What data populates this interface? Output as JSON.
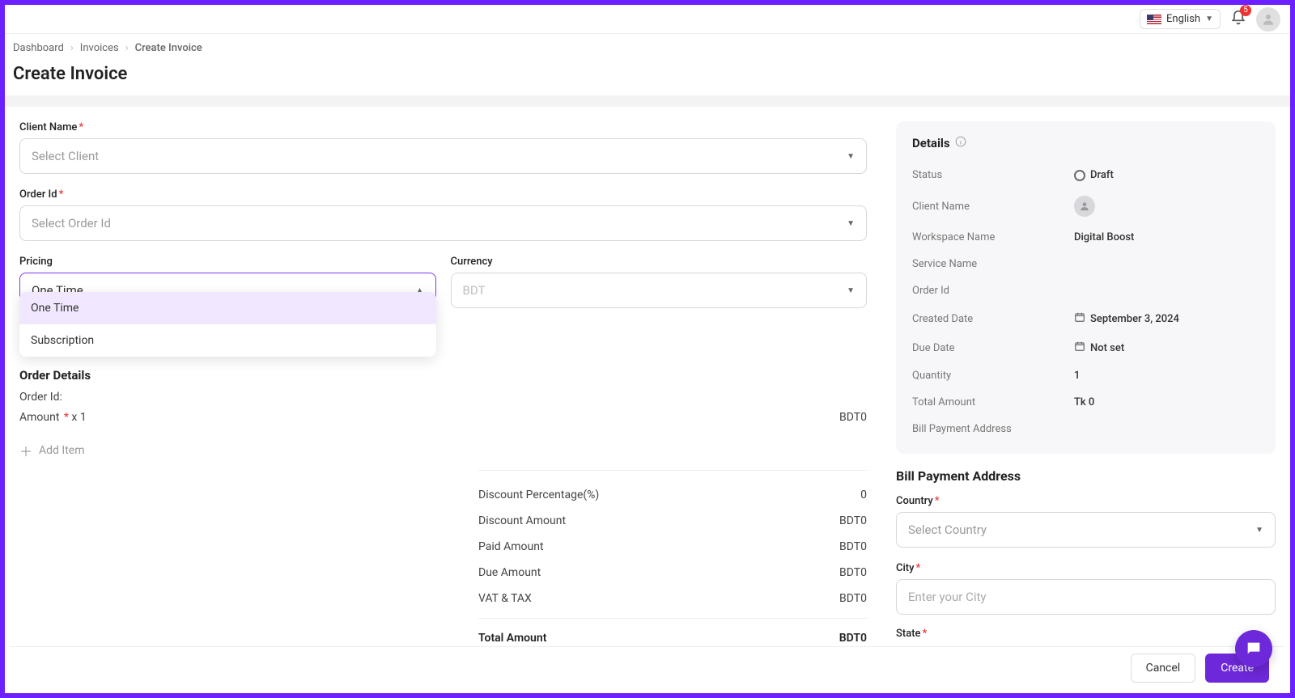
{
  "header": {
    "language": "English",
    "notification_count": "5"
  },
  "breadcrumb": {
    "items": [
      "Dashboard",
      "Invoices",
      "Create Invoice"
    ]
  },
  "page_title": "Create Invoice",
  "form": {
    "client_name": {
      "label": "Client Name",
      "placeholder": "Select Client"
    },
    "order_id": {
      "label": "Order Id",
      "placeholder": "Select Order Id"
    },
    "pricing": {
      "label": "Pricing",
      "value": "One Time",
      "options": [
        "One Time",
        "Subscription"
      ]
    },
    "currency": {
      "label": "Currency",
      "value": "BDT"
    }
  },
  "order_details": {
    "title": "Order Details",
    "order_id_label": "Order Id:",
    "amount_line_prefix": "Amount",
    "amount_line_suffix": " x 1",
    "amount_value": "BDT0",
    "add_item": "Add Item"
  },
  "totals": {
    "rows": [
      {
        "label": "Discount Percentage(%)",
        "value": "0"
      },
      {
        "label": "Discount Amount",
        "value": "BDT0"
      },
      {
        "label": "Paid Amount",
        "value": "BDT0"
      },
      {
        "label": "Due Amount",
        "value": "BDT0"
      },
      {
        "label": "VAT & TAX",
        "value": "BDT0"
      }
    ],
    "total": {
      "label": "Total Amount",
      "value": "BDT0"
    }
  },
  "details": {
    "title": "Details",
    "status_label": "Status",
    "status_value": "Draft",
    "client_name_label": "Client Name",
    "workspace_label": "Workspace Name",
    "workspace_value": "Digital Boost",
    "service_label": "Service Name",
    "order_id_label": "Order Id",
    "created_label": "Created Date",
    "created_value": "September 3, 2024",
    "due_label": "Due Date",
    "due_value": "Not set",
    "quantity_label": "Quantity",
    "quantity_value": "1",
    "total_label": "Total Amount",
    "total_value": "Tk 0",
    "bpa_label": "Bill Payment Address"
  },
  "bill_address": {
    "title": "Bill Payment Address",
    "country": {
      "label": "Country",
      "placeholder": "Select Country"
    },
    "city": {
      "label": "City",
      "placeholder": "Enter your City"
    },
    "state": {
      "label": "State"
    }
  },
  "footer": {
    "cancel": "Cancel",
    "create": "Create"
  }
}
